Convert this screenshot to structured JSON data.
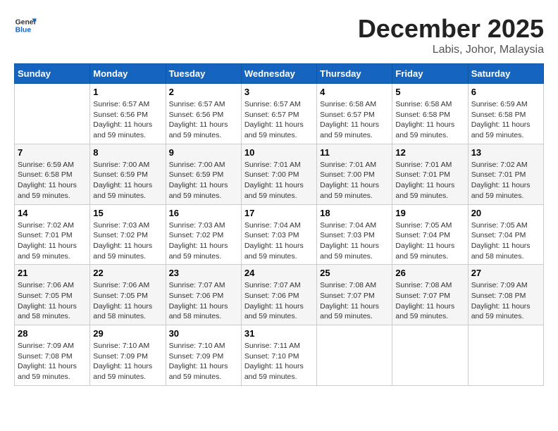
{
  "header": {
    "logo_general": "General",
    "logo_blue": "Blue",
    "month_title": "December 2025",
    "location": "Labis, Johor, Malaysia"
  },
  "weekdays": [
    "Sunday",
    "Monday",
    "Tuesday",
    "Wednesday",
    "Thursday",
    "Friday",
    "Saturday"
  ],
  "weeks": [
    [
      {
        "day": "",
        "sunrise": "",
        "sunset": "",
        "daylight": ""
      },
      {
        "day": "1",
        "sunrise": "Sunrise: 6:57 AM",
        "sunset": "Sunset: 6:56 PM",
        "daylight": "Daylight: 11 hours and 59 minutes."
      },
      {
        "day": "2",
        "sunrise": "Sunrise: 6:57 AM",
        "sunset": "Sunset: 6:56 PM",
        "daylight": "Daylight: 11 hours and 59 minutes."
      },
      {
        "day": "3",
        "sunrise": "Sunrise: 6:57 AM",
        "sunset": "Sunset: 6:57 PM",
        "daylight": "Daylight: 11 hours and 59 minutes."
      },
      {
        "day": "4",
        "sunrise": "Sunrise: 6:58 AM",
        "sunset": "Sunset: 6:57 PM",
        "daylight": "Daylight: 11 hours and 59 minutes."
      },
      {
        "day": "5",
        "sunrise": "Sunrise: 6:58 AM",
        "sunset": "Sunset: 6:58 PM",
        "daylight": "Daylight: 11 hours and 59 minutes."
      },
      {
        "day": "6",
        "sunrise": "Sunrise: 6:59 AM",
        "sunset": "Sunset: 6:58 PM",
        "daylight": "Daylight: 11 hours and 59 minutes."
      }
    ],
    [
      {
        "day": "7",
        "sunrise": "Sunrise: 6:59 AM",
        "sunset": "Sunset: 6:58 PM",
        "daylight": "Daylight: 11 hours and 59 minutes."
      },
      {
        "day": "8",
        "sunrise": "Sunrise: 7:00 AM",
        "sunset": "Sunset: 6:59 PM",
        "daylight": "Daylight: 11 hours and 59 minutes."
      },
      {
        "day": "9",
        "sunrise": "Sunrise: 7:00 AM",
        "sunset": "Sunset: 6:59 PM",
        "daylight": "Daylight: 11 hours and 59 minutes."
      },
      {
        "day": "10",
        "sunrise": "Sunrise: 7:01 AM",
        "sunset": "Sunset: 7:00 PM",
        "daylight": "Daylight: 11 hours and 59 minutes."
      },
      {
        "day": "11",
        "sunrise": "Sunrise: 7:01 AM",
        "sunset": "Sunset: 7:00 PM",
        "daylight": "Daylight: 11 hours and 59 minutes."
      },
      {
        "day": "12",
        "sunrise": "Sunrise: 7:01 AM",
        "sunset": "Sunset: 7:01 PM",
        "daylight": "Daylight: 11 hours and 59 minutes."
      },
      {
        "day": "13",
        "sunrise": "Sunrise: 7:02 AM",
        "sunset": "Sunset: 7:01 PM",
        "daylight": "Daylight: 11 hours and 59 minutes."
      }
    ],
    [
      {
        "day": "14",
        "sunrise": "Sunrise: 7:02 AM",
        "sunset": "Sunset: 7:01 PM",
        "daylight": "Daylight: 11 hours and 59 minutes."
      },
      {
        "day": "15",
        "sunrise": "Sunrise: 7:03 AM",
        "sunset": "Sunset: 7:02 PM",
        "daylight": "Daylight: 11 hours and 59 minutes."
      },
      {
        "day": "16",
        "sunrise": "Sunrise: 7:03 AM",
        "sunset": "Sunset: 7:02 PM",
        "daylight": "Daylight: 11 hours and 59 minutes."
      },
      {
        "day": "17",
        "sunrise": "Sunrise: 7:04 AM",
        "sunset": "Sunset: 7:03 PM",
        "daylight": "Daylight: 11 hours and 59 minutes."
      },
      {
        "day": "18",
        "sunrise": "Sunrise: 7:04 AM",
        "sunset": "Sunset: 7:03 PM",
        "daylight": "Daylight: 11 hours and 59 minutes."
      },
      {
        "day": "19",
        "sunrise": "Sunrise: 7:05 AM",
        "sunset": "Sunset: 7:04 PM",
        "daylight": "Daylight: 11 hours and 59 minutes."
      },
      {
        "day": "20",
        "sunrise": "Sunrise: 7:05 AM",
        "sunset": "Sunset: 7:04 PM",
        "daylight": "Daylight: 11 hours and 58 minutes."
      }
    ],
    [
      {
        "day": "21",
        "sunrise": "Sunrise: 7:06 AM",
        "sunset": "Sunset: 7:05 PM",
        "daylight": "Daylight: 11 hours and 58 minutes."
      },
      {
        "day": "22",
        "sunrise": "Sunrise: 7:06 AM",
        "sunset": "Sunset: 7:05 PM",
        "daylight": "Daylight: 11 hours and 58 minutes."
      },
      {
        "day": "23",
        "sunrise": "Sunrise: 7:07 AM",
        "sunset": "Sunset: 7:06 PM",
        "daylight": "Daylight: 11 hours and 58 minutes."
      },
      {
        "day": "24",
        "sunrise": "Sunrise: 7:07 AM",
        "sunset": "Sunset: 7:06 PM",
        "daylight": "Daylight: 11 hours and 59 minutes."
      },
      {
        "day": "25",
        "sunrise": "Sunrise: 7:08 AM",
        "sunset": "Sunset: 7:07 PM",
        "daylight": "Daylight: 11 hours and 59 minutes."
      },
      {
        "day": "26",
        "sunrise": "Sunrise: 7:08 AM",
        "sunset": "Sunset: 7:07 PM",
        "daylight": "Daylight: 11 hours and 59 minutes."
      },
      {
        "day": "27",
        "sunrise": "Sunrise: 7:09 AM",
        "sunset": "Sunset: 7:08 PM",
        "daylight": "Daylight: 11 hours and 59 minutes."
      }
    ],
    [
      {
        "day": "28",
        "sunrise": "Sunrise: 7:09 AM",
        "sunset": "Sunset: 7:08 PM",
        "daylight": "Daylight: 11 hours and 59 minutes."
      },
      {
        "day": "29",
        "sunrise": "Sunrise: 7:10 AM",
        "sunset": "Sunset: 7:09 PM",
        "daylight": "Daylight: 11 hours and 59 minutes."
      },
      {
        "day": "30",
        "sunrise": "Sunrise: 7:10 AM",
        "sunset": "Sunset: 7:09 PM",
        "daylight": "Daylight: 11 hours and 59 minutes."
      },
      {
        "day": "31",
        "sunrise": "Sunrise: 7:11 AM",
        "sunset": "Sunset: 7:10 PM",
        "daylight": "Daylight: 11 hours and 59 minutes."
      },
      {
        "day": "",
        "sunrise": "",
        "sunset": "",
        "daylight": ""
      },
      {
        "day": "",
        "sunrise": "",
        "sunset": "",
        "daylight": ""
      },
      {
        "day": "",
        "sunrise": "",
        "sunset": "",
        "daylight": ""
      }
    ]
  ]
}
